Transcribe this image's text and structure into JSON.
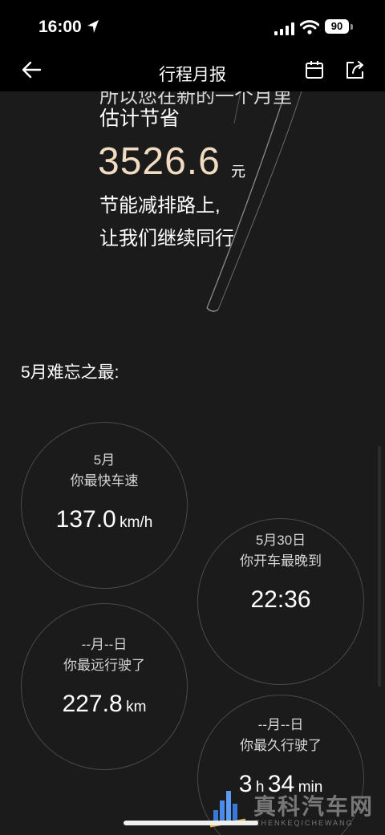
{
  "status_bar": {
    "time": "16:00",
    "battery": "90"
  },
  "nav": {
    "title": "行程月报"
  },
  "summary": {
    "cut_text": "所以您在新的一个月里",
    "est_label": "估计节省",
    "amount": "3526.6",
    "amount_unit": "元",
    "slogan_line1": "节能减排路上,",
    "slogan_line2": "让我们继续同行"
  },
  "section": {
    "title": "5月难忘之最:"
  },
  "cards": [
    {
      "line1": "5月",
      "line2": "你最快车速",
      "value": "137.0",
      "unit": "km/h"
    },
    {
      "line1": "5月30日",
      "line2": "你开车最晚到",
      "value": "22:36"
    },
    {
      "line1": "--月--日",
      "line2": "你最远行驶了",
      "value": "227.8",
      "unit": "km"
    },
    {
      "line1": "--月--日",
      "line2": "你最久行驶了",
      "v1": "3",
      "u1": "h",
      "v2": "34",
      "u2": "min"
    }
  ],
  "watermark": {
    "cn": "真科汽车网",
    "en": "ZHENKEQICHEWANG"
  }
}
